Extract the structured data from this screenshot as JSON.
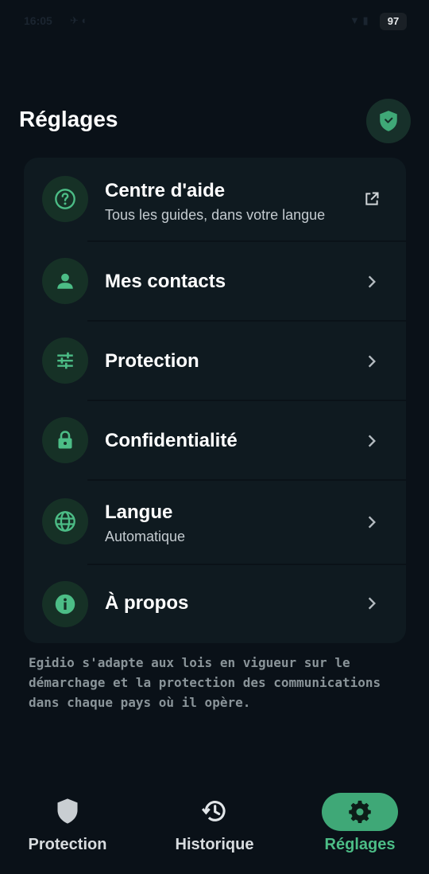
{
  "status_bar": {
    "time": "16:05",
    "battery": "97"
  },
  "header": {
    "title": "Réglages",
    "badge_icon": "shield-check-icon"
  },
  "menu": [
    {
      "label": "Centre d'aide",
      "subtitle": "Tous les guides, dans votre langue",
      "icon": "help-circle-icon",
      "trailing": "external-link-icon"
    },
    {
      "label": "Mes contacts",
      "subtitle": "",
      "icon": "person-icon",
      "trailing": "chevron-right-icon"
    },
    {
      "label": "Protection",
      "subtitle": "",
      "icon": "sliders-icon",
      "trailing": "chevron-right-icon"
    },
    {
      "label": "Confidentialité",
      "subtitle": "",
      "icon": "lock-icon",
      "trailing": "chevron-right-icon"
    },
    {
      "label": "Langue",
      "subtitle": "Automatique",
      "icon": "globe-icon",
      "trailing": "chevron-right-icon"
    },
    {
      "label": "À propos",
      "subtitle": "",
      "icon": "info-icon",
      "trailing": "chevron-right-icon"
    }
  ],
  "footnote": "Egidio s'adapte aux lois en vigueur sur le\ndémarchage et la protection des communications\ndans chaque pays où il opère.",
  "bottom_nav": [
    {
      "label": "Protection",
      "icon": "shield-icon",
      "active": false
    },
    {
      "label": "Historique",
      "icon": "history-icon",
      "active": false
    },
    {
      "label": "Réglages",
      "icon": "gear-icon",
      "active": true
    }
  ],
  "colors": {
    "background": "#0a1118",
    "card": "#0f1a20",
    "icon_circle": "#163126",
    "accent": "#4cbd86",
    "active_pill": "#3fa877"
  }
}
